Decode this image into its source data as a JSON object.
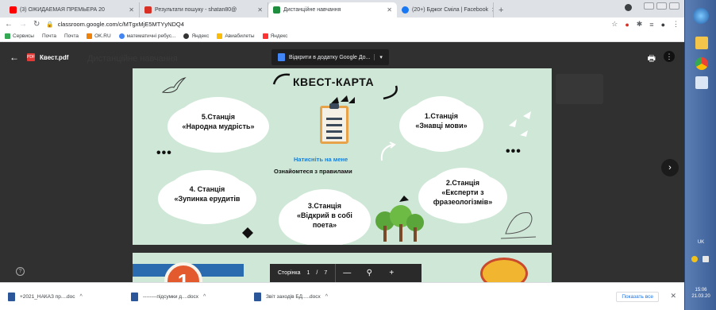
{
  "browser": {
    "tabs": [
      {
        "title": "(3) ОЖИДАЕМАЯ ПРЕМЬЕРА 20",
        "favicon": "youtube-icon",
        "color": "#ff0000"
      },
      {
        "title": "Результати пошуку - shatan80@",
        "favicon": "gmail-icon",
        "color": "#d93025"
      },
      {
        "title": "Дистанційне навчання",
        "favicon": "classroom-icon",
        "color": "#1e8e3e"
      },
      {
        "title": "(20+) Бджог Сміла | Facebook",
        "favicon": "facebook-icon",
        "color": "#1877f2"
      }
    ],
    "new_tab": "+",
    "url": "classroom.google.com/c/MTgxMjE5MTYyNDQ4",
    "bookmarks": [
      {
        "label": "Сервисы",
        "color": "#34a853"
      },
      {
        "label": "Почта",
        "color": "#ffffff"
      },
      {
        "label": "Почта",
        "color": "#ffffff"
      },
      {
        "label": "OK.RU",
        "color": "#ee8208"
      },
      {
        "label": "математичні ребус...",
        "color": "#4285f4"
      },
      {
        "label": "Яндекс",
        "color": "#333333"
      },
      {
        "label": "Авиабилеты",
        "color": "#fbbc05"
      },
      {
        "label": "Яндекс",
        "color": "#ff3333"
      }
    ]
  },
  "viewer": {
    "file_name": "Квест.pdf",
    "background_title": "Дистанційне навчання",
    "open_with": "Відкрити в додатку Google До...",
    "pager": {
      "label": "Сторінка",
      "current": "1",
      "separator": "/",
      "total": "7",
      "zoom_out": "—",
      "zoom_in": "+"
    }
  },
  "quest": {
    "title": "КВЕСТ-КАРТА",
    "hint_click": "Натисніть на мене",
    "hint_rules": "Ознайомтеся з правилами",
    "dots": "•••",
    "stations": [
      {
        "line1": "1.Станція",
        "line2": "«Знавці мови»"
      },
      {
        "line1": "2.Станція",
        "line2": "«Експерти з",
        "line3": "фразеологізмів»"
      },
      {
        "line1": "3.Станція",
        "line2": "«Відкрий в собі",
        "line3": "поета»"
      },
      {
        "line1": "4. Станція",
        "line2": "«Зупинка ерудитів"
      },
      {
        "line1": "5.Станція",
        "line2": "«Народна мудрість»"
      }
    ],
    "page2_number": "1"
  },
  "downloads": {
    "items": [
      {
        "name": "+2021_НАКАЗ пр....doc"
      },
      {
        "name": "--------підсумки д....docx"
      },
      {
        "name": "Звіт заходів БД.....docx"
      }
    ],
    "show_all": "Показать все",
    "close": "✕"
  },
  "taskbar": {
    "lang": "UK",
    "time": "15:06",
    "date": "21.03.20"
  }
}
